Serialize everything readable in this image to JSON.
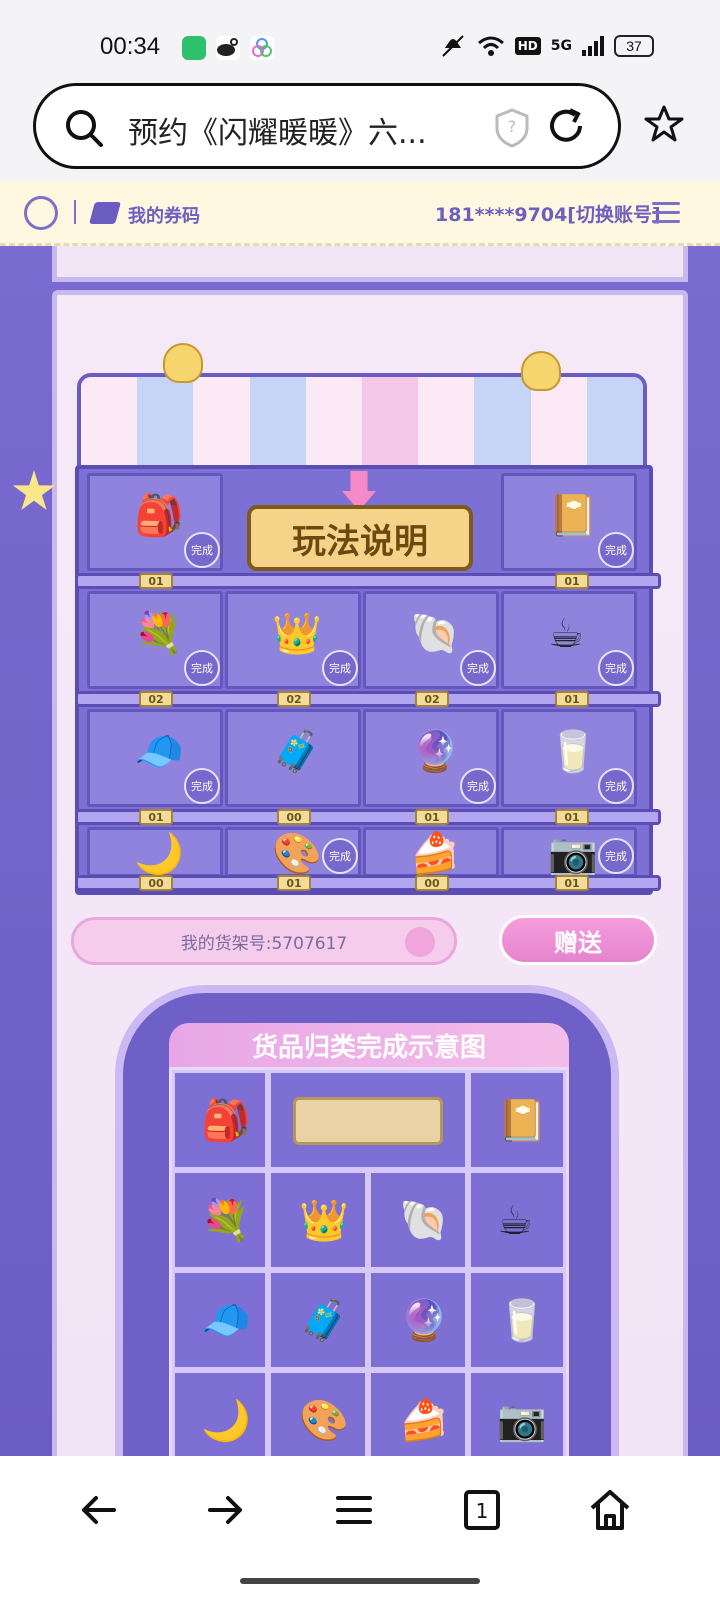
{
  "status_bar": {
    "time": "00:34",
    "battery": "37",
    "network": "5G",
    "hd": "HD"
  },
  "browser": {
    "url_text": "预约《闪耀暖暖》六..."
  },
  "topbar": {
    "my_code": "我的券码",
    "account": "181****9704[切换账号]"
  },
  "shelf": {
    "play_button": "玩法说明",
    "done_label": "完成",
    "rows": [
      [
        {
          "icon": "backpack",
          "count": "01",
          "done": true
        },
        {
          "icon": "guide-button",
          "count": "",
          "done": false
        },
        {
          "icon": "",
          "count": "",
          "done": false
        },
        {
          "icon": "photo-album",
          "count": "01",
          "done": true
        }
      ],
      [
        {
          "icon": "flower-basket",
          "count": "02",
          "done": true
        },
        {
          "icon": "perfume-bottle",
          "count": "02",
          "done": true
        },
        {
          "icon": "shell-box",
          "count": "02",
          "done": true
        },
        {
          "icon": "bunny-mug",
          "count": "01",
          "done": true
        }
      ],
      [
        {
          "icon": "cat-beret",
          "count": "01",
          "done": true
        },
        {
          "icon": "suitcase",
          "count": "00",
          "done": false
        },
        {
          "icon": "crystal-ball",
          "count": "01",
          "done": true
        },
        {
          "icon": "milk-carton",
          "count": "01",
          "done": true
        }
      ],
      [
        {
          "icon": "moon-pillow",
          "count": "00",
          "done": false
        },
        {
          "icon": "eyeshadow-palette",
          "count": "01",
          "done": true
        },
        {
          "icon": "cake-slice",
          "count": "00",
          "done": false
        },
        {
          "icon": "camera",
          "count": "01",
          "done": true
        }
      ]
    ],
    "shelf_number": "我的货架号:5707617",
    "gift_button": "赠送"
  },
  "summary": {
    "title": "货品归类完成示意图"
  },
  "colors": {
    "accent": "#6b5cc4",
    "pink": "#f59ddc",
    "gold": "#f5d48a"
  }
}
